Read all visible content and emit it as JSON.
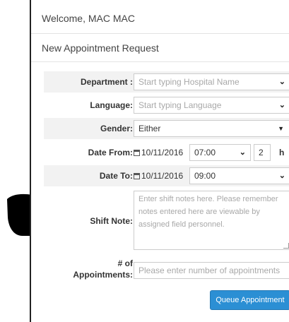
{
  "header": {
    "welcome": "Welcome,  MAC MAC"
  },
  "form": {
    "title": "New Appointment Request",
    "department": {
      "label": "Department :",
      "placeholder": "Start typing Hospital Name"
    },
    "language": {
      "label": "Language:",
      "placeholder": "Start typing Language"
    },
    "gender": {
      "label": "Gender:",
      "value": "Either"
    },
    "date_from": {
      "label": "Date From:",
      "date": "10/11/2016",
      "time": "07:00",
      "hours": "2",
      "hours_unit": "h"
    },
    "date_to": {
      "label": "Date To:",
      "date": "10/11/2016",
      "time": "09:00"
    },
    "shift_note": {
      "label": "Shift Note:",
      "placeholder": "Enter shift notes here. Please remember notes entered here are viewable by assigned field personnel."
    },
    "appointments": {
      "label_line1": "# of",
      "label_line2": "Appointments:",
      "placeholder": "Please enter number of appointments"
    },
    "submit_label": "Queue Appointment"
  },
  "icons": {
    "pointer": "pointing-hand-icon",
    "calendar": "calendar-icon",
    "chevron": "chevron-down-icon"
  },
  "colors": {
    "accent": "#2b8fd4",
    "stripe": "#f2f2f2"
  }
}
